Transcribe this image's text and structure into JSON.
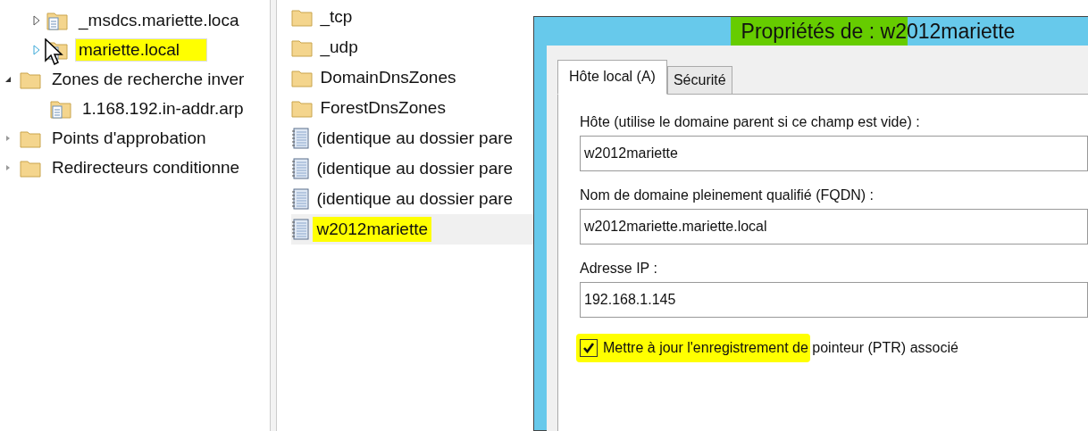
{
  "tree": [
    {
      "label": "_msdcs.mariette.loca",
      "kind": "zone",
      "expanded": false,
      "selected": false,
      "highlighted": false
    },
    {
      "label": "mariette.local",
      "kind": "zone",
      "expanded": false,
      "selected": true,
      "highlighted": true
    },
    {
      "label": "Zones de recherche inver",
      "kind": "folder",
      "expanded": true,
      "selected": false,
      "highlighted": false,
      "children": [
        {
          "label": "1.168.192.in-addr.arp",
          "kind": "zone",
          "selected": false,
          "highlighted": false
        }
      ]
    },
    {
      "label": "Points d'approbation",
      "kind": "folder",
      "expanded": false,
      "selected": false,
      "highlighted": false
    },
    {
      "label": "Redirecteurs conditionne",
      "kind": "folder",
      "expanded": false,
      "selected": false,
      "highlighted": false
    }
  ],
  "list": [
    {
      "label": "_tcp",
      "kind": "folder",
      "selected": false,
      "highlighted": false
    },
    {
      "label": "_udp",
      "kind": "folder",
      "selected": false,
      "highlighted": false
    },
    {
      "label": "DomainDnsZones",
      "kind": "folder",
      "selected": false,
      "highlighted": false
    },
    {
      "label": "ForestDnsZones",
      "kind": "folder",
      "selected": false,
      "highlighted": false
    },
    {
      "label": "(identique au dossier pare",
      "kind": "record",
      "selected": false,
      "highlighted": false
    },
    {
      "label": "(identique au dossier pare",
      "kind": "record",
      "selected": false,
      "highlighted": false
    },
    {
      "label": "(identique au dossier pare",
      "kind": "record",
      "selected": false,
      "highlighted": false
    },
    {
      "label": "w2012mariette",
      "kind": "record",
      "selected": true,
      "highlighted": true
    }
  ],
  "dialog": {
    "title": "Propriétés de : w2012mariette",
    "title_highlighted": true,
    "tabs": [
      {
        "label": "Hôte local (A)",
        "selected": true
      },
      {
        "label": "Sécurité",
        "selected": false
      }
    ],
    "fields": [
      {
        "label": "Hôte (utilise le domaine parent si ce champ est vide) :",
        "value": "w2012mariette"
      },
      {
        "label": "Nom de domaine pleinement qualifié (FQDN) :",
        "value": "w2012mariette.mariette.local"
      },
      {
        "label": "Adresse IP :",
        "value": "192.168.1.145"
      }
    ],
    "checkbox": {
      "label": "Mettre à jour l'enregistrement de pointeur (PTR) associé",
      "checked": true,
      "highlighted": true
    }
  }
}
